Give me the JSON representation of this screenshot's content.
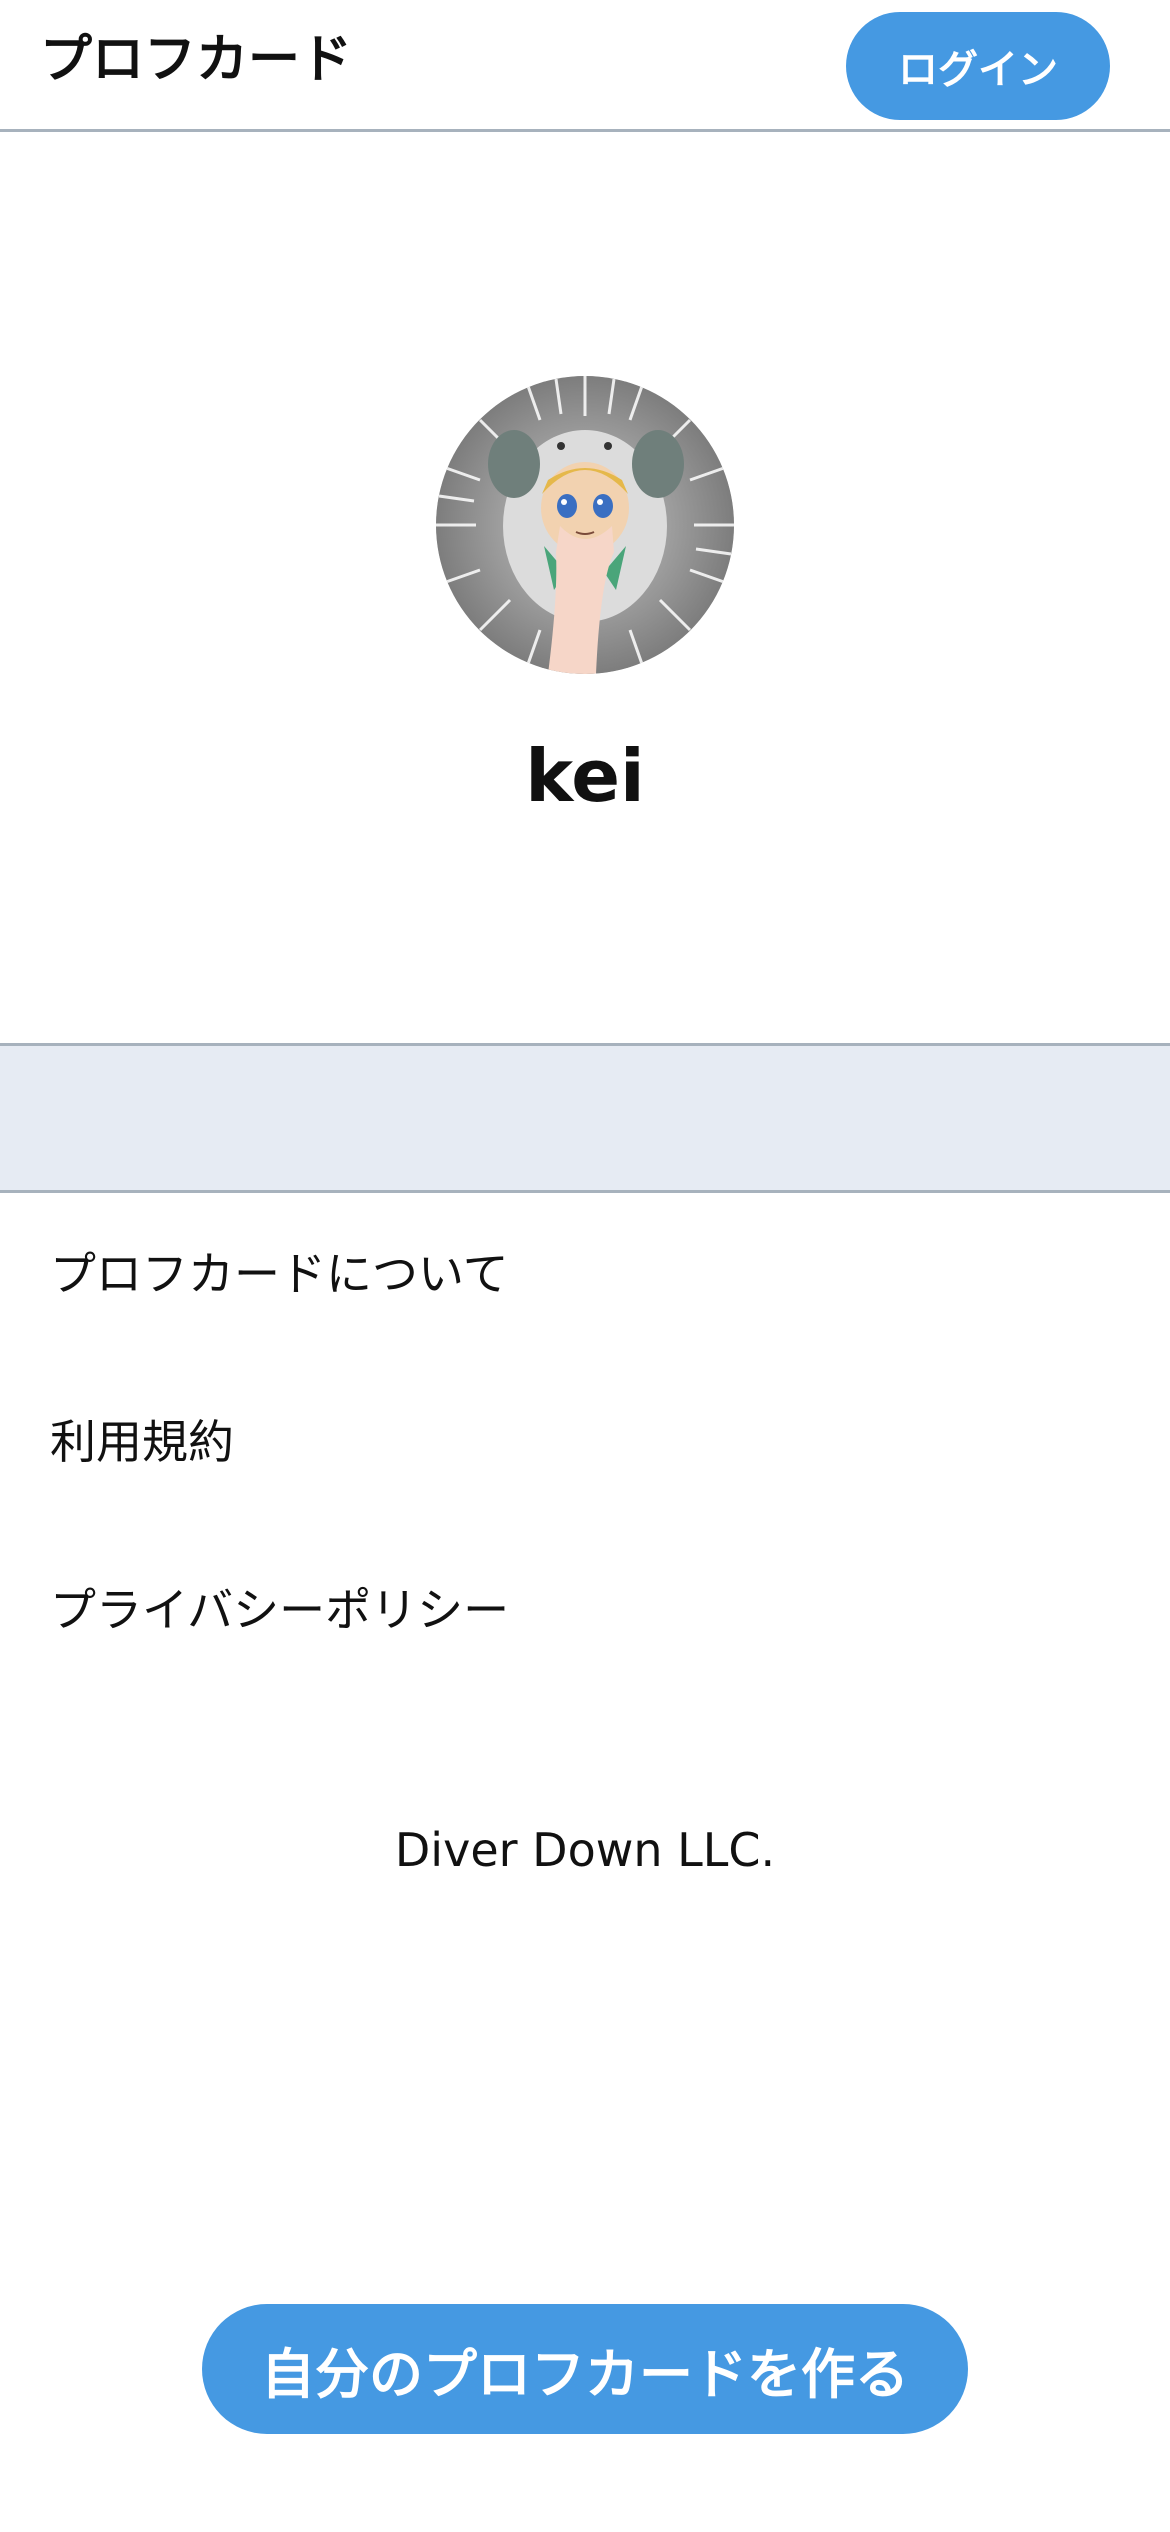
{
  "header": {
    "title": "プロフカード",
    "login_label": "ログイン"
  },
  "profile": {
    "username": "kei",
    "avatar_icon": "avatar-image"
  },
  "footer": {
    "links": [
      {
        "label": "プロフカードについて"
      },
      {
        "label": "利用規約"
      },
      {
        "label": "プライバシーポリシー"
      }
    ],
    "company": "Diver Down LLC."
  },
  "cta": {
    "label": "自分のプロフカードを作る"
  },
  "colors": {
    "accent": "#4599e2",
    "band": "#e6ebf3",
    "divider": "#a7b2bd"
  }
}
